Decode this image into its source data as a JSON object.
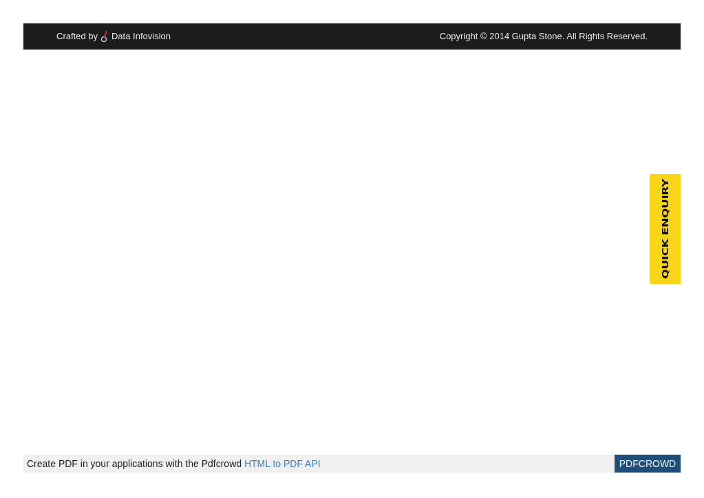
{
  "footer": {
    "credit_prefix": "Crafted by",
    "credit_name": "Data Infovision",
    "copyright": "Copyright © 2014 Gupta Stone. All Rights Reserved."
  },
  "quick_enquiry": {
    "label": "QUICK ENQUIRY"
  },
  "pdf_banner": {
    "text": "Create PDF in your applications with the Pdfcrowd",
    "link": "HTML to PDF API",
    "badge": "PDFCROWD"
  }
}
